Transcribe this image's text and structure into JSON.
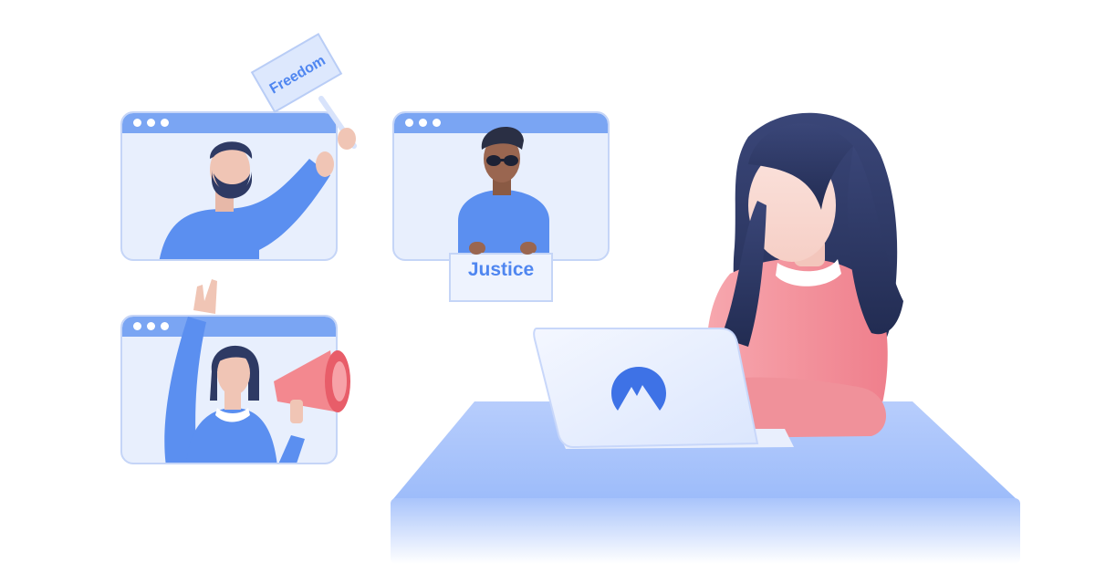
{
  "signs": {
    "freedom": "Freedom",
    "justice": "Justice"
  },
  "colors": {
    "window_bar": "#7aa5f3",
    "window_bg": "#e8effd",
    "window_border": "#c5d5f7",
    "brand_blue": "#4f86f0",
    "shirt_pink": "#f28a94",
    "desk_blue": "#a9c4fb",
    "hair_dark": "#2d3a64"
  },
  "icons": {
    "laptop_logo": "mountain-logo-icon",
    "window_controls": "three-dots-icon",
    "megaphone": "megaphone-icon"
  }
}
